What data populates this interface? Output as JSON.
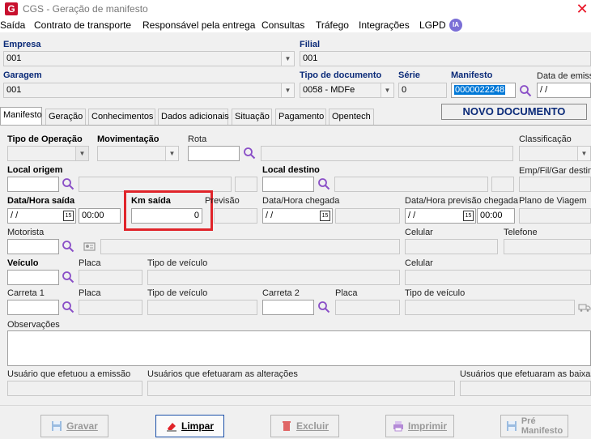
{
  "window": {
    "title": "CGS - Geração de manifesto",
    "logo_letter": "G"
  },
  "menu": {
    "items": [
      "Saída",
      "Contrato de transporte",
      "Responsável pela entrega",
      "Consultas",
      "Tráfego",
      "Integrações",
      "LGPD"
    ],
    "ia_badge": "IA"
  },
  "header": {
    "empresa_label": "Empresa",
    "empresa_value": "001",
    "filial_label": "Filial",
    "filial_value": "001",
    "garagem_label": "Garagem",
    "garagem_value": "001",
    "tipo_doc_label": "Tipo de documento",
    "tipo_doc_value": "0058 - MDFe",
    "serie_label": "Série",
    "serie_value": "0",
    "manifesto_label": "Manifesto",
    "manifesto_value": "0000022248",
    "data_emissao_label": "Data de emiss",
    "data_emissao_value": " /  /",
    "status": "NOVO DOCUMENTO"
  },
  "tabs": [
    "Manifesto",
    "Geração",
    "Conhecimentos",
    "Dados adicionais",
    "Situação",
    "Pagamento",
    "Opentech"
  ],
  "form": {
    "tipo_operacao_label": "Tipo de Operação",
    "movimentacao_label": "Movimentação",
    "rota_label": "Rota",
    "classificacao_label": "Classificação",
    "local_origem_label": "Local origem",
    "local_destino_label": "Local destino",
    "emp_fil_gar_label": "Emp/Fil/Gar destin",
    "data_saida_label": "Data/Hora saída",
    "data_saida_value": " /  /",
    "hora_saida_value": "00:00",
    "km_saida_label": "Km saída",
    "km_saida_value": "0",
    "previsao_label": "Previsão",
    "data_chegada_label": "Data/Hora chegada",
    "data_chegada_value": " /  /",
    "data_prev_chegada_label": "Data/Hora previsão chegada",
    "data_prev_value": " /  /",
    "hora_prev_value": "00:00",
    "plano_viagem_label": "Plano de Viagem",
    "motorista_label": "Motorista",
    "celular_label": "Celular",
    "telefone_label": "Telefone",
    "veiculo_label": "Veículo",
    "placa_label": "Placa",
    "tipo_veiculo_label": "Tipo de veículo",
    "celular2_label": "Celular",
    "carreta1_label": "Carreta 1",
    "carreta2_label": "Carreta 2",
    "observacoes_label": "Observações",
    "usuario_emissao_label": "Usuário que efetuou a emissão",
    "usuarios_alteracoes_label": "Usuários que efetuaram as alterações",
    "usuarios_baixas_label": "Usuários que efetuaram as baixas"
  },
  "buttons": {
    "gravar": "Gravar",
    "limpar": "Limpar",
    "excluir": "Excluir",
    "imprimir": "Imprimir",
    "pre_manifesto_1": "Pré",
    "pre_manifesto_2": "Manifesto"
  },
  "colors": {
    "label_blue": "#0a2a78",
    "highlight_red": "#e0242a",
    "selection": "#0078d7"
  }
}
